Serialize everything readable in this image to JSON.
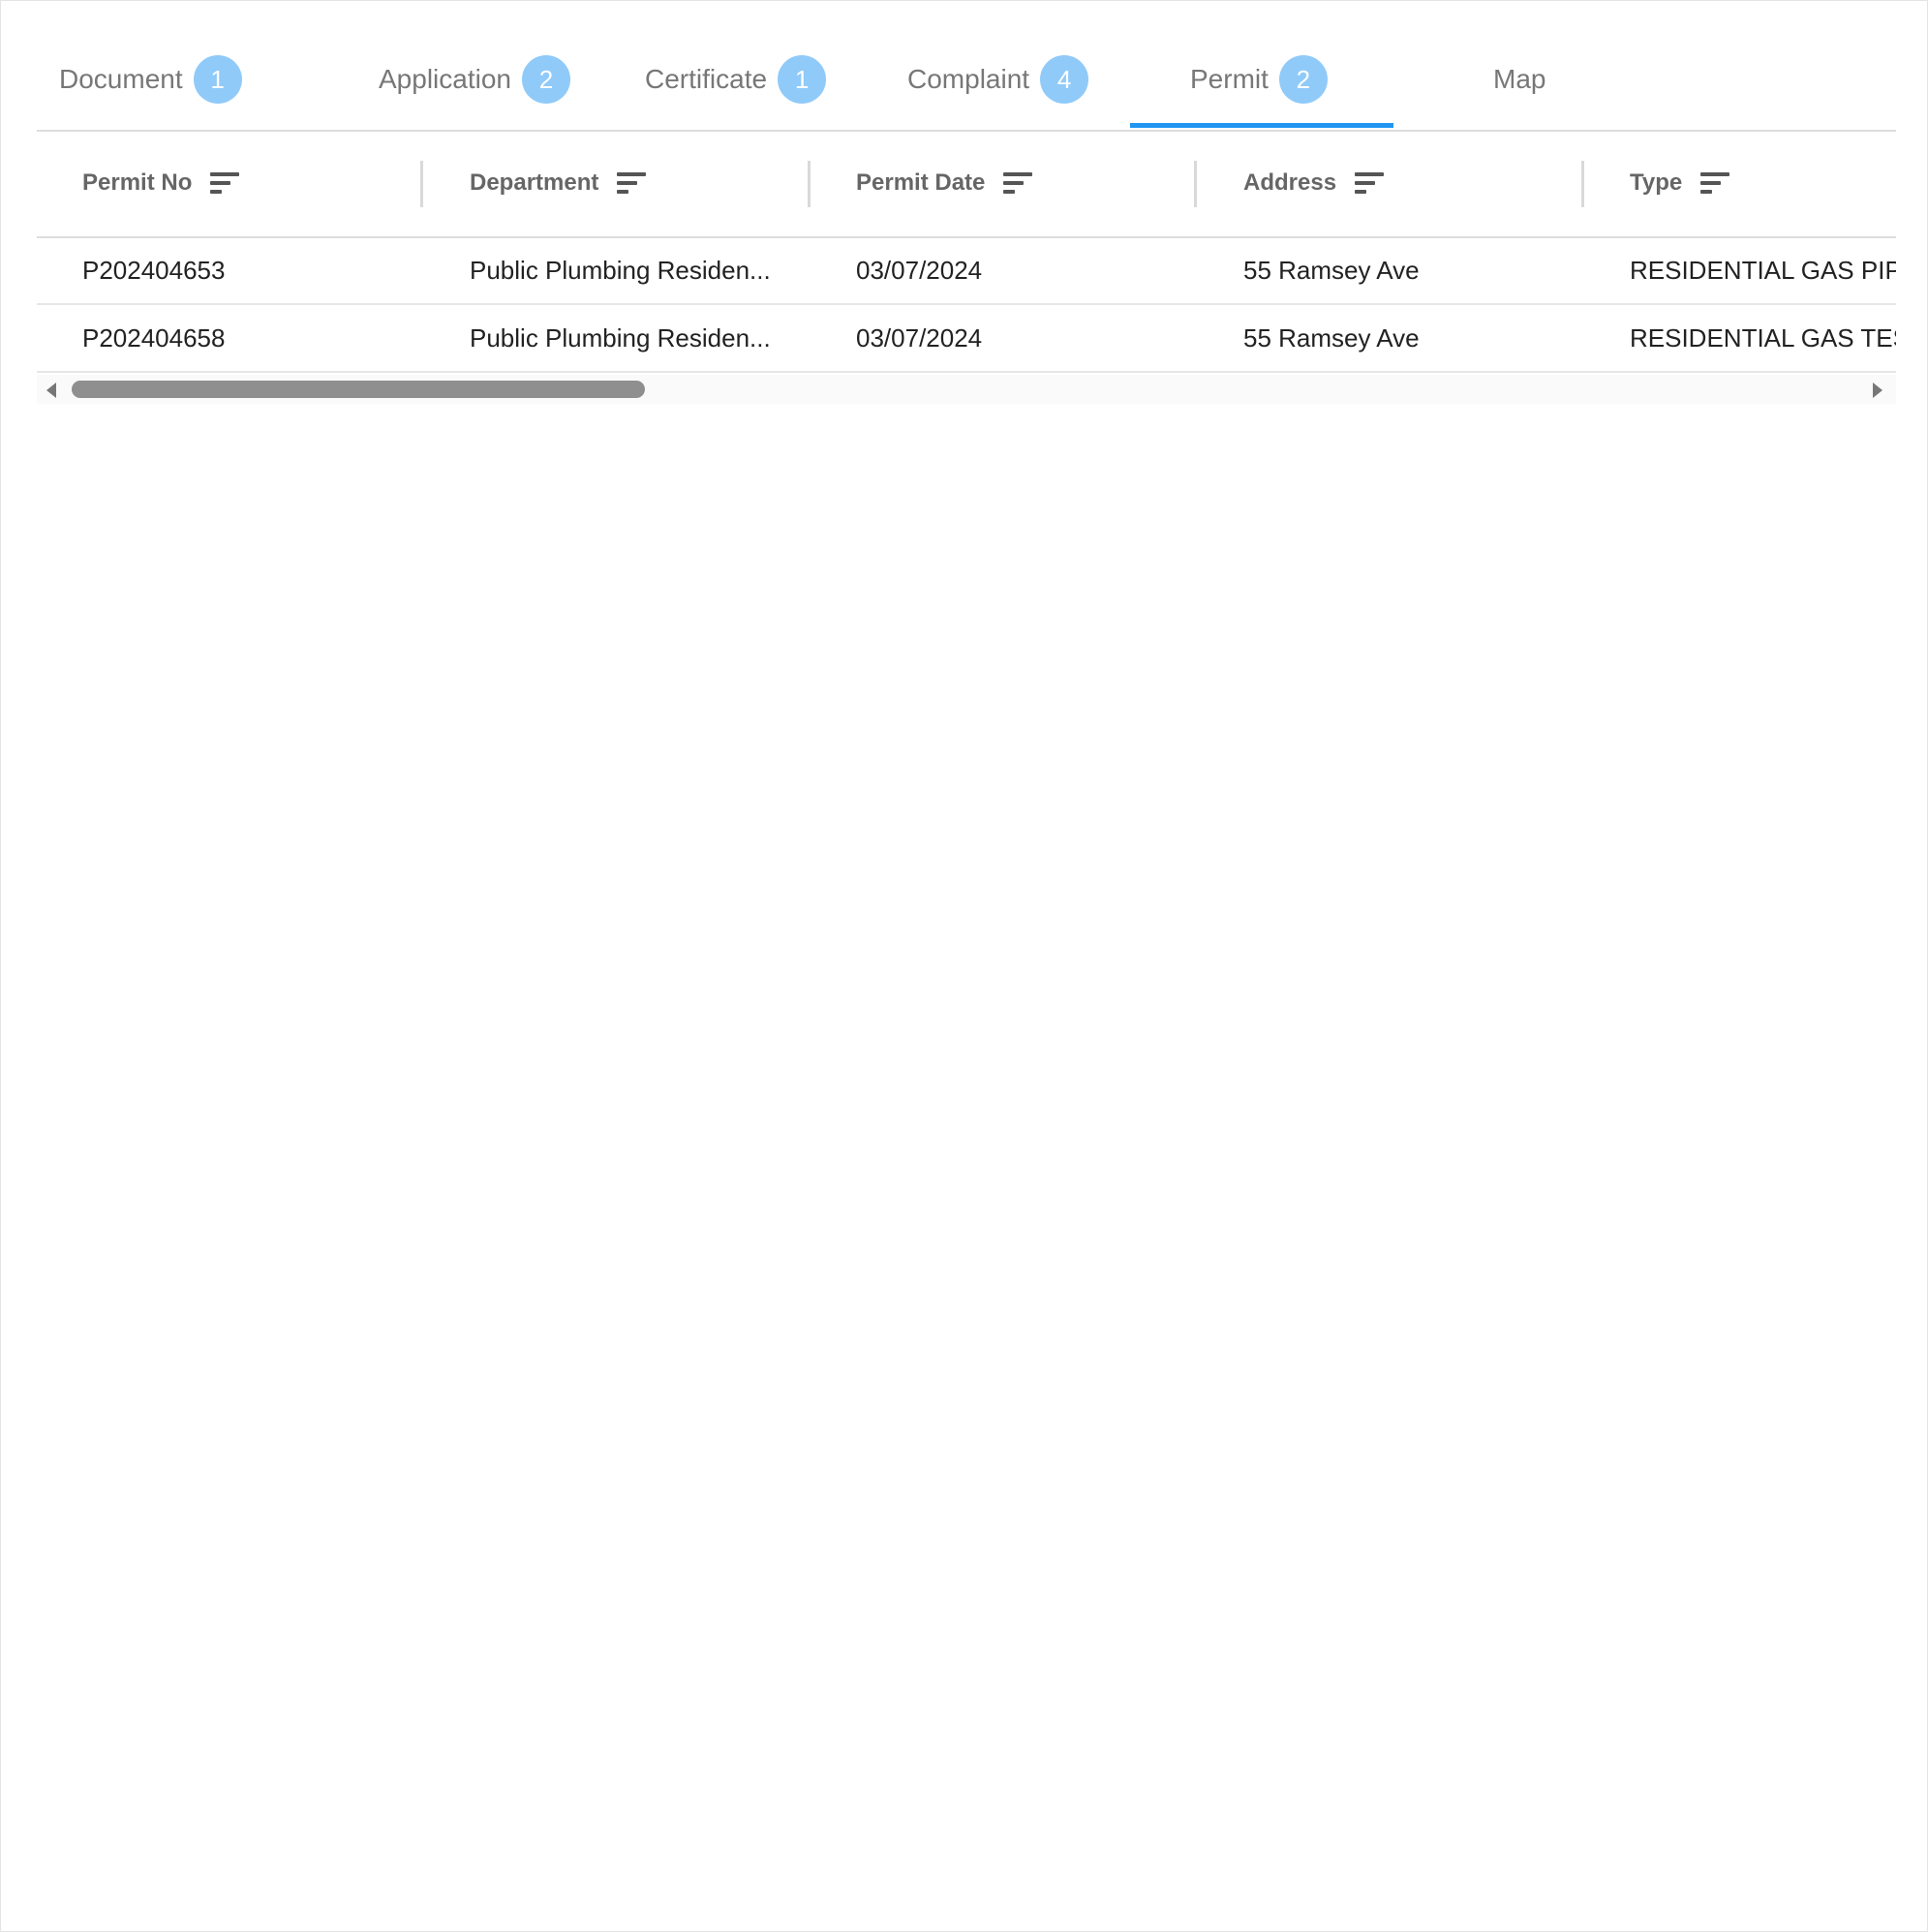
{
  "tabs": [
    {
      "label": "Document",
      "badge": "1"
    },
    {
      "label": "Application",
      "badge": "2"
    },
    {
      "label": "Certificate",
      "badge": "1"
    },
    {
      "label": "Complaint",
      "badge": "4"
    },
    {
      "label": "Permit",
      "badge": "2"
    },
    {
      "label": "Map",
      "badge": ""
    }
  ],
  "active_tab": "Permit",
  "table": {
    "columns": [
      "Permit No",
      "Department",
      "Permit Date",
      "Address",
      "Type"
    ],
    "rows": [
      {
        "permit_no": "P202404653",
        "department": "Public Plumbing Residen...",
        "permit_date": "03/07/2024",
        "address": "55 Ramsey Ave",
        "type": "RESIDENTIAL GAS PIPIN"
      },
      {
        "permit_no": "P202404658",
        "department": "Public Plumbing Residen...",
        "permit_date": "03/07/2024",
        "address": "55 Ramsey Ave",
        "type": "RESIDENTIAL GAS TEST"
      }
    ]
  },
  "icons": {
    "sort": "sort-lines-icon",
    "scroll_left": "triangle-left-icon",
    "scroll_right": "triangle-right-icon"
  },
  "colors": {
    "accent": "#2196f3",
    "badge": "#90caf9",
    "tab_text": "#777777",
    "header_text": "#666666",
    "cell_text": "#222222"
  }
}
